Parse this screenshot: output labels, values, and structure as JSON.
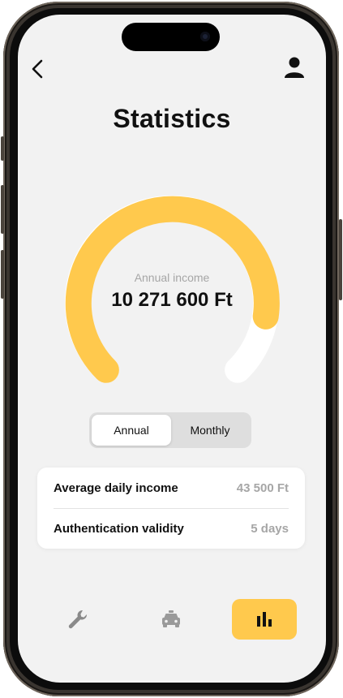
{
  "app": {
    "title": "Statistics"
  },
  "header": {
    "back_icon": "chevron-left-icon",
    "profile_icon": "user-icon"
  },
  "gauge": {
    "label": "Annual income",
    "value": "10 271 600 Ft",
    "fill_fraction": 0.8,
    "fill_color": "#ffc94d",
    "track_color": "#ffffff"
  },
  "period_toggle": {
    "options": [
      "Annual",
      "Monthly"
    ],
    "selected": "Annual"
  },
  "stats": {
    "rows": [
      {
        "label": "Average daily income",
        "value": "43 500 Ft"
      },
      {
        "label": "Authentication validity",
        "value": "5 days"
      }
    ]
  },
  "bottom_nav": {
    "items": [
      {
        "icon": "wrench-icon",
        "active": false
      },
      {
        "icon": "taxi-icon",
        "active": false
      },
      {
        "icon": "bar-chart-icon",
        "active": true
      }
    ],
    "accent_color": "#ffc94d"
  }
}
